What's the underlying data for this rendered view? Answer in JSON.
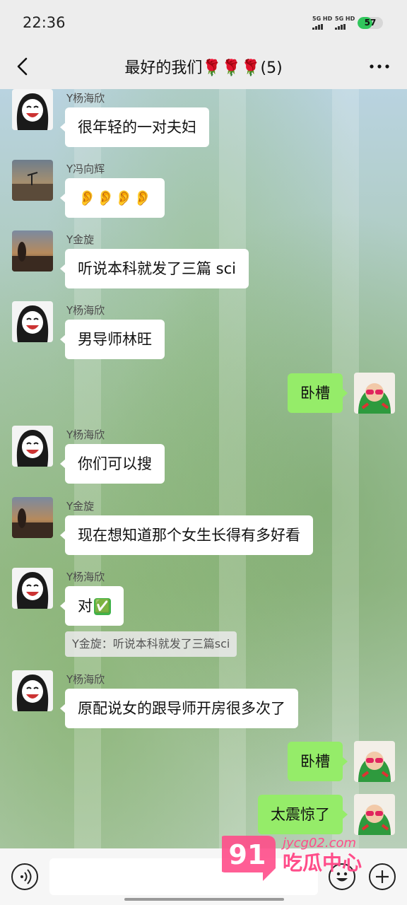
{
  "status": {
    "time": "22:36",
    "sim1": "5G HD",
    "sim2": "5G HD",
    "battery": 57
  },
  "header": {
    "title": "最好的我们🌹🌹🌹(5)"
  },
  "messages": [
    {
      "sender": "Y杨海欣",
      "text": "很年轻的一对夫妇"
    },
    {
      "sender": "Y冯向辉",
      "text": "👂👂👂👂"
    },
    {
      "sender": "Y金旋",
      "text": "听说本科就发了三篇 sci"
    },
    {
      "sender": "Y杨海欣",
      "text": "男导师林旺"
    },
    {
      "sender": "me",
      "text": "卧槽"
    },
    {
      "sender": "Y杨海欣",
      "text": "你们可以搜"
    },
    {
      "sender": "Y金旋",
      "text": "现在想知道那个女生长得有多好看"
    },
    {
      "sender": "Y杨海欣",
      "text": "对",
      "emoji": "✅",
      "quote": "Y金旋：听说本科就发了三篇sci"
    },
    {
      "sender": "Y杨海欣",
      "text": "原配说女的跟导师开房很多次了"
    },
    {
      "sender": "me",
      "text": "卧槽"
    },
    {
      "sender": "me",
      "text": "太震惊了"
    }
  ],
  "watermark": {
    "badge": "91",
    "site": "jycg02.com",
    "name": "吃瓜中心"
  },
  "icons": {
    "back": "chevron-left-icon",
    "more": "more-dots-icon",
    "voice": "voice-icon",
    "emoji": "emoji-icon",
    "plus": "plus-icon"
  },
  "colors": {
    "outgoing_bubble": "#95ec69",
    "incoming_bubble": "#ffffff",
    "bar_bg": "#ededed",
    "watermark_pink": "#ff4d8a"
  }
}
